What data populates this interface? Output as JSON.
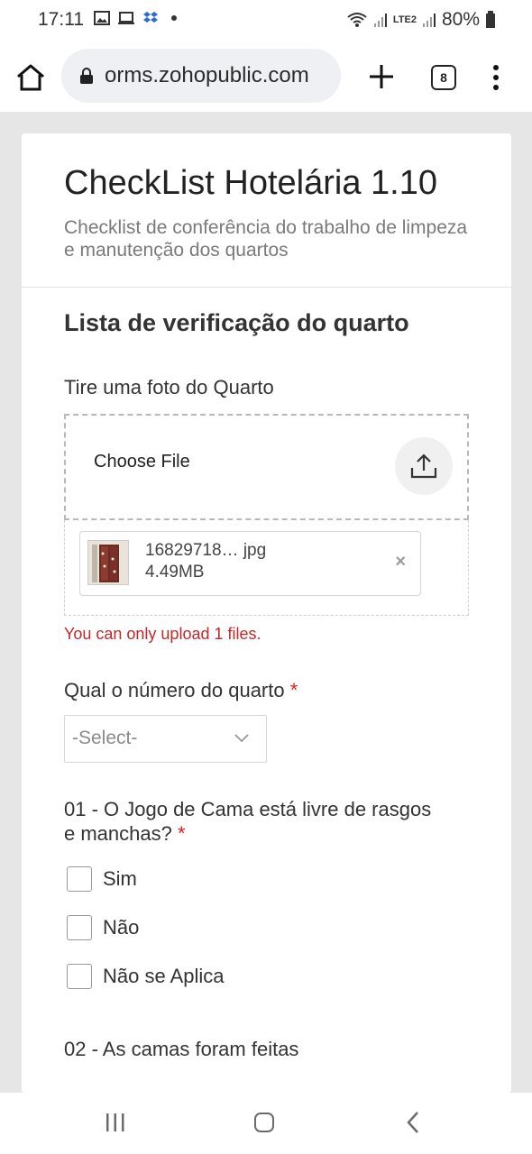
{
  "status_bar": {
    "time": "17:11",
    "network": "LTE2",
    "battery": "80%"
  },
  "browser": {
    "url": "orms.zohopublic.com",
    "tab_count": "8"
  },
  "form": {
    "title": "CheckList Hotelária 1.10",
    "description": "Checklist de conferência do trabalho de limpeza e manutenção dos quartos",
    "section_title": "Lista de verificação do quarto",
    "photo_field": {
      "label": "Tire uma foto do Quarto",
      "choose_label": "Choose File",
      "file_name": "16829718… jpg",
      "file_size": "4.49MB",
      "remove_glyph": "×",
      "error": "You can only upload 1 files."
    },
    "room_field": {
      "label": "Qual o número do quarto",
      "required_mark": "*",
      "select_value": "-Select-"
    },
    "q1": {
      "label": "01 - O Jogo de Cama está livre de rasgos e manchas?",
      "required_mark": "*",
      "options": [
        "Sim",
        "Não",
        "Não se Aplica"
      ]
    },
    "q2": {
      "label": "02 - As camas foram feitas"
    }
  },
  "colors": {
    "error": "#c62828",
    "required": "#dd2222",
    "page_bg": "#e6e6e6"
  }
}
